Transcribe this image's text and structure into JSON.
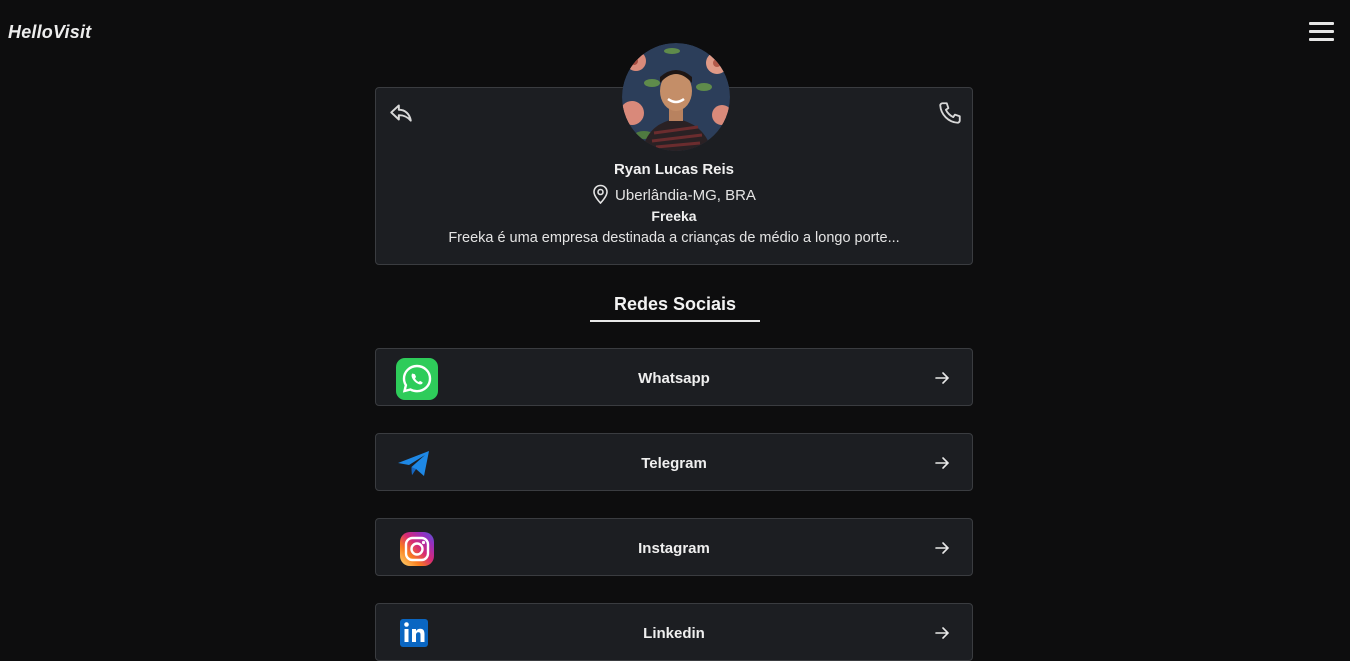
{
  "header": {
    "brand": "HelloVisit"
  },
  "profile": {
    "name": "Ryan Lucas Reis",
    "location": "Uberlândia-MG, BRA",
    "company": "Freeka",
    "description": "Freeka é uma empresa destinada a crianças de médio a longo porte..."
  },
  "section": {
    "title": "Redes Sociais"
  },
  "socials": [
    {
      "label": "Whatsapp",
      "icon": "whatsapp-icon",
      "color": "#25D366"
    },
    {
      "label": "Telegram",
      "icon": "telegram-icon",
      "color": "#1e88e5"
    },
    {
      "label": "Instagram",
      "icon": "instagram-icon",
      "color": "#e1306c"
    },
    {
      "label": "Linkedin",
      "icon": "linkedin-icon",
      "color": "#0a66c2"
    }
  ],
  "colors": {
    "background": "#0d0d0e",
    "card": "#1c1e22",
    "border": "#3a3c40"
  }
}
